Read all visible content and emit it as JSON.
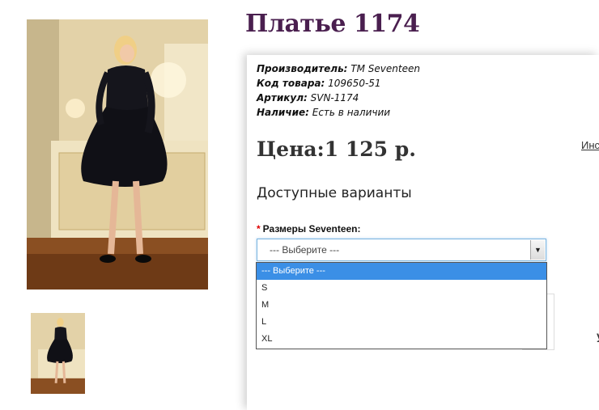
{
  "product": {
    "title": "Платье 1174",
    "specs": [
      {
        "label": "Производитель:",
        "value": "ТМ Seventeen"
      },
      {
        "label": "Код товара:",
        "value": "109650-51"
      },
      {
        "label": "Артикул:",
        "value": "SVN-1174"
      },
      {
        "label": "Наличие:",
        "value": "Есть в наличии"
      }
    ],
    "price": "Цена:1 125 р.",
    "side_link": "Инс"
  },
  "options": {
    "heading": "Доступные варианты",
    "required_mark": "*",
    "size_label": "Размеры Seventeen:",
    "selected": "--- Выберите ---",
    "choices": [
      "--- Выберите ---",
      "S",
      "M",
      "L",
      "XL"
    ]
  },
  "icons": {
    "dropdown_arrow": "chevron-down-icon"
  },
  "colors": {
    "title": "#4a1f4f",
    "highlight": "#3b8fe6",
    "required": "#e00000"
  }
}
